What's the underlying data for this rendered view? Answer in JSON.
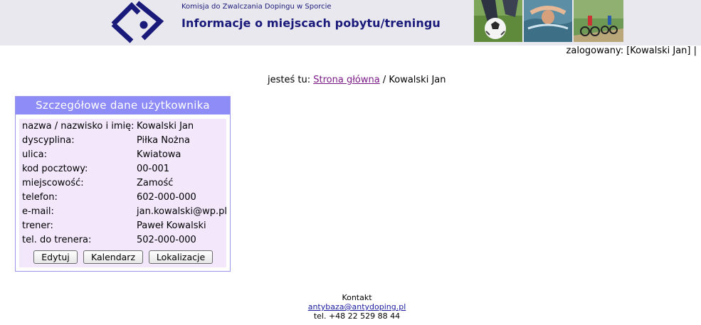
{
  "header": {
    "org_name": "Komisja do Zwalczania Dopingu w Sporcie",
    "site_title": "Informacje o miejscach pobytu/treningu"
  },
  "colors": {
    "header_bg": "#e9e8ee",
    "brand_navy": "#1a1a7a",
    "panel_header": "#8e8cf6",
    "panel_body": "#f2e7fb",
    "link_visited": "#7a1a86",
    "link": "#1a1aa0"
  },
  "user_bar": {
    "logged_in": "zalogowany: [Kowalski Jan] |"
  },
  "breadcrumb": {
    "prefix": "jesteś tu:",
    "home_link": "Strona główna",
    "separator": "/",
    "current": "Kowalski Jan"
  },
  "panel": {
    "title": "Szczegółowe dane użytkownika",
    "rows": [
      {
        "label": "nazwa / nazwisko i imię:",
        "value": "Kowalski Jan"
      },
      {
        "label": "dyscyplina:",
        "value": "Piłka Nożna"
      },
      {
        "label": "ulica:",
        "value": "Kwiatowa"
      },
      {
        "label": "kod pocztowy:",
        "value": "00-001"
      },
      {
        "label": "miejscowość:",
        "value": "Zamość"
      },
      {
        "label": "telefon:",
        "value": "602-000-000"
      },
      {
        "label": "e-mail:",
        "value": "jan.kowalski@wp.pl"
      },
      {
        "label": "trener:",
        "value": "Paweł Kowalski"
      },
      {
        "label": "tel. do trenera:",
        "value": "502-000-000"
      }
    ],
    "buttons": {
      "edit": "Edytuj",
      "calendar": "Kalendarz",
      "locations": "Lokalizacje"
    }
  },
  "footer": {
    "contact_label": "Kontakt",
    "email": "antybaza@antydoping.pl",
    "phone": "tel. +48 22 529 88 44"
  }
}
